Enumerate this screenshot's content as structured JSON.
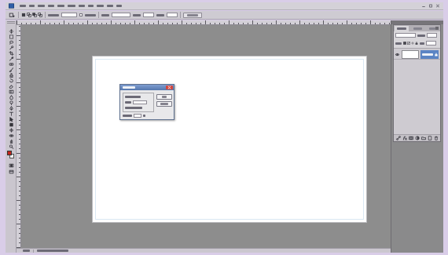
{
  "theme": {
    "frame": "#d9cde8",
    "chrome": "#d4d1d8",
    "workspace": "#8d8d8d",
    "canvas": "#ffffff",
    "dialog_title": "#5577ad",
    "dialog_close": "#d4463c",
    "layer_selection": "#5b84c4"
  },
  "app_bar": {
    "logo_icon": "photoshop-logo-icon",
    "window_controls": [
      "minimize-icon",
      "maximize-icon",
      "close-icon"
    ]
  },
  "options_bar": {
    "preset_icon": "tool-preset-icon",
    "selection_modes": [
      "new-selection-icon",
      "add-to-selection-icon",
      "subtract-from-selection-icon",
      "intersect-selection-icon"
    ]
  },
  "toolbar": {
    "tools": [
      "move-tool-icon",
      "marquee-tool-icon",
      "lasso-tool-icon",
      "quick-selection-tool-icon",
      "crop-tool-icon",
      "eyedropper-tool-icon",
      "spot-healing-tool-icon",
      "brush-tool-icon",
      "clone-stamp-tool-icon",
      "history-brush-tool-icon",
      "eraser-tool-icon",
      "gradient-tool-icon",
      "blur-tool-icon",
      "dodge-tool-icon",
      "pen-tool-icon",
      "type-tool-icon",
      "path-selection-tool-icon",
      "shape-tool-icon",
      "3d-rotate-tool-icon",
      "3d-orbit-tool-icon",
      "hand-tool-icon",
      "zoom-tool-icon"
    ],
    "foreground_color": "#c4261c",
    "background_color": "#f2f2f2",
    "modes": [
      "quick-mask-icon",
      "screen-mode-icon"
    ]
  },
  "dialog": {
    "close_icon": "close-icon"
  },
  "layers_panel": {
    "menu_icon": "panel-menu-icon",
    "lock_icons": [
      "lock-transparency-icon",
      "lock-pixels-icon",
      "lock-position-icon",
      "lock-all-icon"
    ],
    "layers": [
      {
        "thumbnail_color": "#ffffff",
        "visible": true,
        "selected": true,
        "locked": true
      }
    ],
    "footer_icons": [
      "link-layers-icon",
      "layer-style-icon",
      "layer-mask-icon",
      "adjustment-layer-icon",
      "new-group-icon",
      "new-layer-icon",
      "delete-layer-icon"
    ]
  }
}
